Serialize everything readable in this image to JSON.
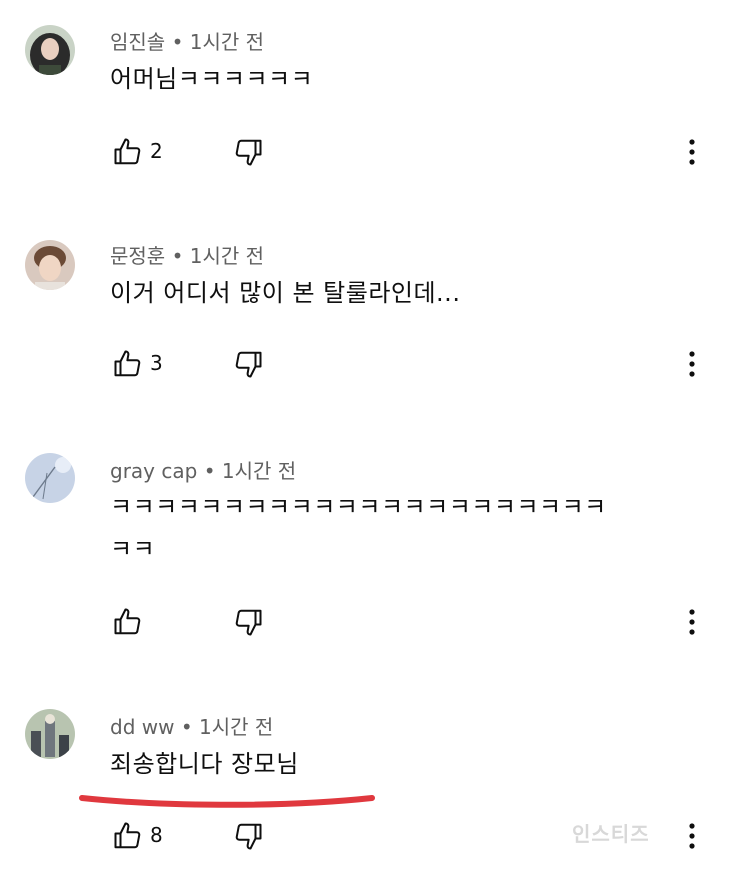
{
  "comments": [
    {
      "author": "임진솔",
      "time": "1시간 전",
      "text": "어머님ㅋㅋㅋㅋㅋㅋ",
      "likes": "2",
      "avatar_icon": "girl-avatar-icon"
    },
    {
      "author": "문정훈",
      "time": "1시간 전",
      "text": "이거 어디서 많이 본 탈룰라인데...",
      "likes": "3",
      "avatar_icon": "face-avatar-icon"
    },
    {
      "author": "gray cap",
      "time": "1시간 전",
      "text": "ㅋㅋㅋㅋㅋㅋㅋㅋㅋㅋㅋㅋㅋㅋㅋㅋㅋㅋㅋㅋㅋㅋ\nㅋㅋ",
      "likes": "",
      "avatar_icon": "sky-avatar-icon"
    },
    {
      "author": "dd ww",
      "time": "1시간 전",
      "text": "죄송합니다 장모님",
      "likes": "8",
      "avatar_icon": "cartoon-avatar-icon"
    }
  ],
  "separator": "•",
  "highlight_color": "#e0383e",
  "watermark": "인스티즈"
}
